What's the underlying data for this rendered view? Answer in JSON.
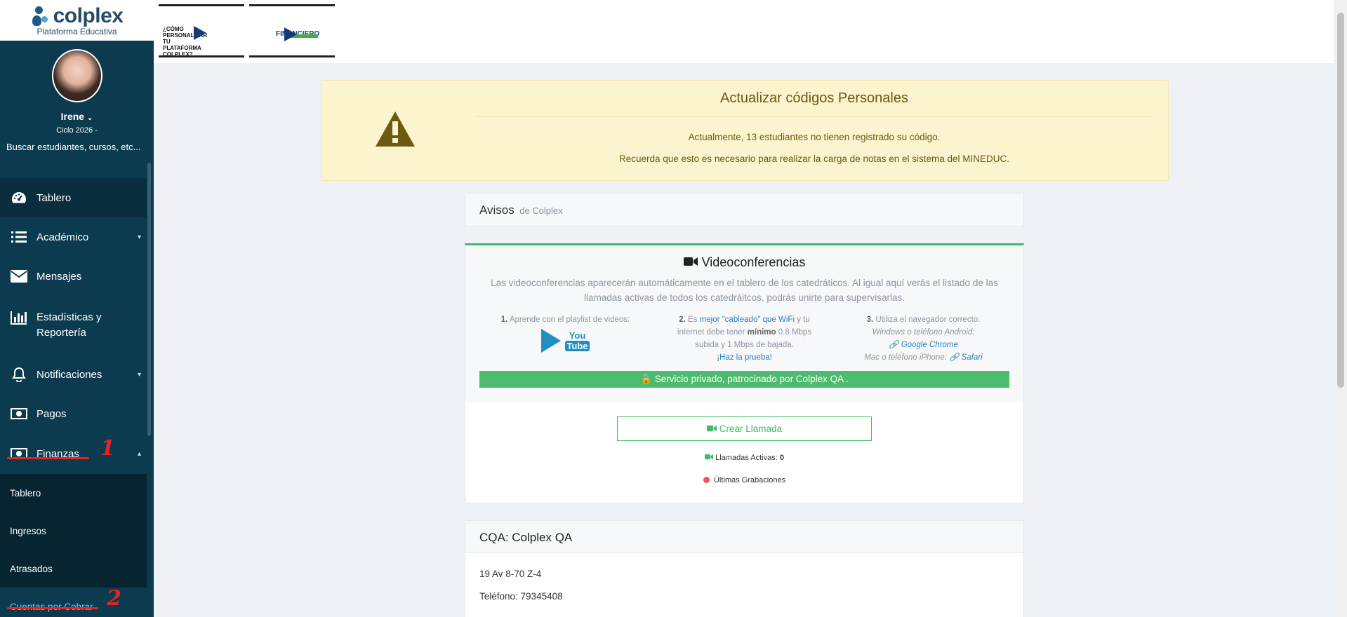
{
  "brand": {
    "name": "colplex",
    "subtitle": "Plataforma Educativa"
  },
  "user": {
    "name": "Irene",
    "ciclo": "Ciclo 2026 -"
  },
  "search": {
    "placeholder": "Buscar estudiantes, cursos, etc..."
  },
  "nav": {
    "tablero": "Tablero",
    "academico": "Académico",
    "mensajes": "Mensajes",
    "estadisticas_1": "Estadísticas y",
    "estadisticas_2": "Reportería",
    "notificaciones": "Notificaciones",
    "pagos": "Pagos",
    "finanzas": "Finanzas",
    "finanzas_sub": [
      "Tablero",
      "Ingresos",
      "Atrasados"
    ],
    "cuentas": "Cuentas por Cobrar"
  },
  "annotations": {
    "n1": "1",
    "n2": "2"
  },
  "thumbs": {
    "t1_text": "¿CÓMO PERSONALIZAR TU PLATAFORMA COLPLEX?",
    "t2_text": "FINANCIERO"
  },
  "alert": {
    "title": "Actualizar códigos Personales",
    "line1": "Actualmente, 13 estudiantes no tienen registrado su código.",
    "line2": "Recuerda que esto es necesario para realizar la carga de notas en el sistema del MINEDUC."
  },
  "avisos": {
    "title": "Avisos",
    "sub": "de Colplex"
  },
  "video": {
    "title": "Videoconferencias",
    "desc": "Las videoconferencias aparecerán automáticamente en el tablero de los catedráticos. Al igual aquí verás el listado de las llamadas activas de todos los catedráitcos, podrás unirte para supervisarlas.",
    "step1_num": "1.",
    "step1_text": "Aprende con el playlist de videos:",
    "yt_you": "You",
    "yt_tube": "Tube",
    "step2_num": "2.",
    "step2_a": "Es",
    "step2_link1": "mejor \"cableado\" que WiFi",
    "step2_b": "y tu internet debe tener",
    "step2_min": "mínimo",
    "step2_c": "0.8 Mbps subida y 1 Mbps de bajada.",
    "step2_link2": "¡Haz la prueba!",
    "step3_num": "3.",
    "step3_text": "Utiliza el navegador correcto.",
    "step3_win": "Windows o teléfono Android:",
    "step3_chrome": "Google Chrome",
    "step3_mac": "Mac o teléfono iPhone:",
    "step3_safari": "Safari",
    "privado": "Servicio privado, patrocinado por Colplex QA .",
    "crear": "Crear Llamada",
    "activas_label": "Llamadas Activas:",
    "activas_count": "0",
    "grabaciones": "Últimas Grabaciones"
  },
  "cqa": {
    "title": "CQA: Colplex QA",
    "address": "19 Av 8-70 Z-4",
    "phone": "Teléfono: 79345408"
  },
  "colors": {
    "sidebar": "#0c3b50",
    "accent_green": "#3fbb63",
    "alert_bg": "#fcf3cf",
    "annotation_red": "#e52421"
  }
}
